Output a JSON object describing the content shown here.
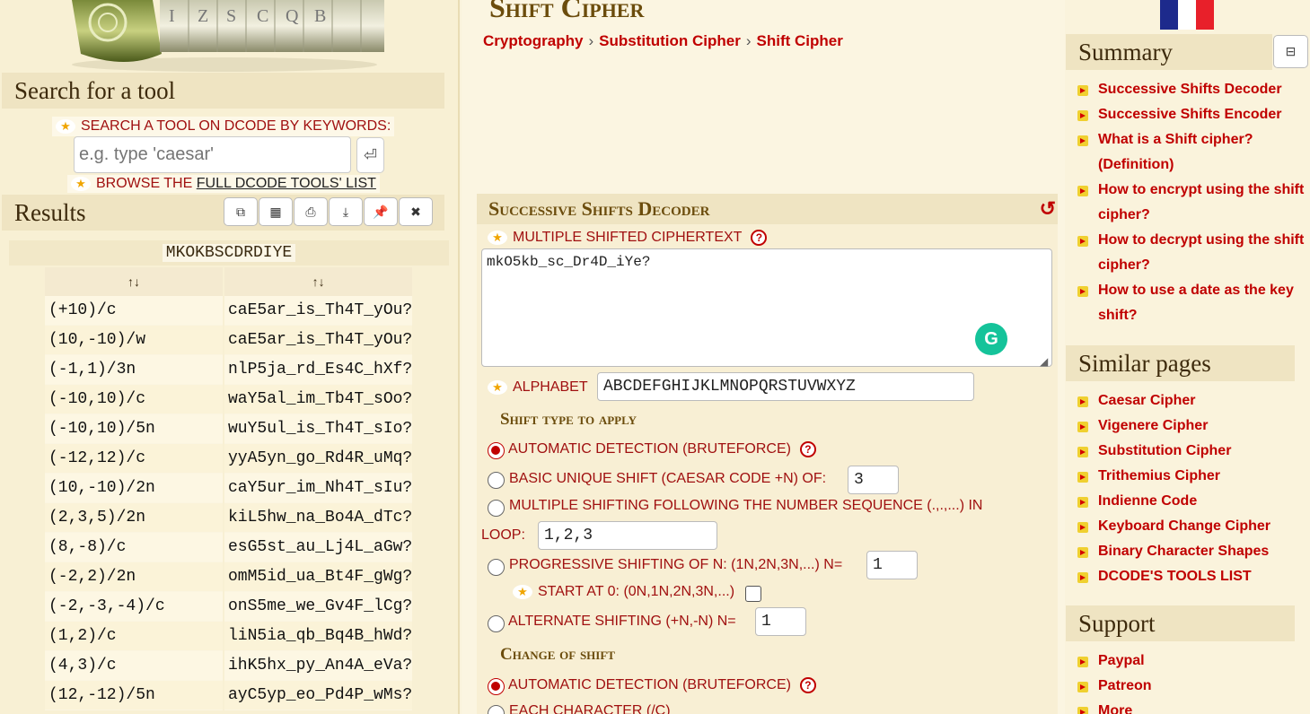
{
  "left": {
    "search_title": "Search for a tool",
    "keywords_label": "SEARCH A TOOL ON DCODE BY KEYWORDS:",
    "search_placeholder": "e.g. type 'caesar'",
    "search_go": "⏎",
    "browse_prefix": "BROWSE THE ",
    "browse_link": "FULL DCODE TOOLS' LIST",
    "results_title": "Results",
    "result_header": "MKOKBSCDRDIYE",
    "col1_header": "↑↓",
    "col2_header": "↑↓",
    "rows": [
      [
        "(+10)/c",
        "caE5ar_is_Th4T_yOu?"
      ],
      [
        "(10,-10)/w",
        "caE5ar_is_Th4T_yOu?"
      ],
      [
        "(-1,1)/3n",
        "nlP5ja_rd_Es4C_hXf?"
      ],
      [
        "(-10,10)/c",
        "waY5al_im_Tb4T_sOo?"
      ],
      [
        "(-10,10)/5n",
        "wuY5ul_is_Th4T_sIo?"
      ],
      [
        "(-12,12)/c",
        "yyA5yn_go_Rd4R_uMq?"
      ],
      [
        "(10,-10)/2n",
        "caY5ur_im_Nh4T_sIu?"
      ],
      [
        "(2,3,5)/2n",
        "kiL5hw_na_Bo4A_dTc?"
      ],
      [
        "(8,-8)/c",
        "esG5st_au_Lj4L_aGw?"
      ],
      [
        "(-2,2)/2n",
        "omM5id_ua_Bt4F_gWg?"
      ],
      [
        "(-2,-3,-4)/c",
        "onS5me_we_Gv4F_lCg?"
      ],
      [
        "(1,2)/c",
        "liN5ia_qb_Bq4B_hWd?"
      ],
      [
        "(4,3)/c",
        "ihK5hx_py_An4A_eVa?"
      ],
      [
        "(12,-12)/5n",
        "ayC5yp_eo_Pd4P_wMs?"
      ]
    ]
  },
  "main": {
    "title": "Shift Cipher",
    "breadcrumb": [
      "Cryptography",
      "Substitution Cipher",
      "Shift Cipher"
    ],
    "breadcrumb_sep": "›",
    "tool_title": "Successive Shifts Decoder",
    "reset_icon": "↺",
    "ciphertext_label": "MULTIPLE SHIFTED CIPHERTEXT",
    "ciphertext_value": "mkO5kb_sc_Dr4D_iYe?",
    "alphabet_label": "ALPHABET",
    "alphabet_value": "ABCDEFGHIJKLMNOPQRSTUVWXYZ",
    "shift_type_heading": "Shift type to apply",
    "opt_auto": "AUTOMATIC DETECTION (BRUTEFORCE)",
    "opt_basic": "BASIC UNIQUE SHIFT (CAESAR CODE +N) OF:",
    "opt_basic_value": "3",
    "opt_multiple_line1": "MULTIPLE SHIFTING FOLLOWING THE NUMBER SEQUENCE (.,.,...) IN",
    "opt_multiple_line2": "LOOP:",
    "opt_multiple_value": "1,2,3",
    "opt_progressive": "PROGRESSIVE SHIFTING OF N: (1N,2N,3N,...) N=",
    "opt_progressive_value": "1",
    "start_zero": "START AT 0: (0N,1N,2N,3N,...)",
    "opt_alternate": "ALTERNATE SHIFTING (+N,-N) N=",
    "opt_alternate_value": "1",
    "change_heading": "Change of shift",
    "change_auto": "AUTOMATIC DETECTION (BRUTEFORCE)",
    "change_each": "EACH CHARACTER (/C)",
    "help": "?",
    "grammarly": "G"
  },
  "right": {
    "summary_title": "Summary",
    "collapse_icon": "⊟",
    "summary_items": [
      "Successive Shifts Decoder",
      "Successive Shifts Encoder",
      "What is a Shift cipher? (Definition)",
      "How to encrypt using the shift cipher?",
      "How to decrypt using the shift cipher?",
      "How to use a date as the key shift?"
    ],
    "similar_title": "Similar pages",
    "similar_items": [
      "Caesar Cipher",
      "Vigenere Cipher",
      "Substitution Cipher",
      "Trithemius Cipher",
      "Indienne Code",
      "Keyboard Change Cipher",
      "Binary Character Shapes",
      "DCODE'S TOOLS LIST"
    ],
    "support_title": "Support",
    "support_items": [
      "Paypal",
      "Patreon",
      "More"
    ]
  },
  "colors": {
    "link": "#c00000",
    "heading": "#6b4c0c",
    "panel": "#efe4c2",
    "flag_blue": "#1d2a8c",
    "flag_white": "#ffffff",
    "flag_red": "#e8202a"
  }
}
